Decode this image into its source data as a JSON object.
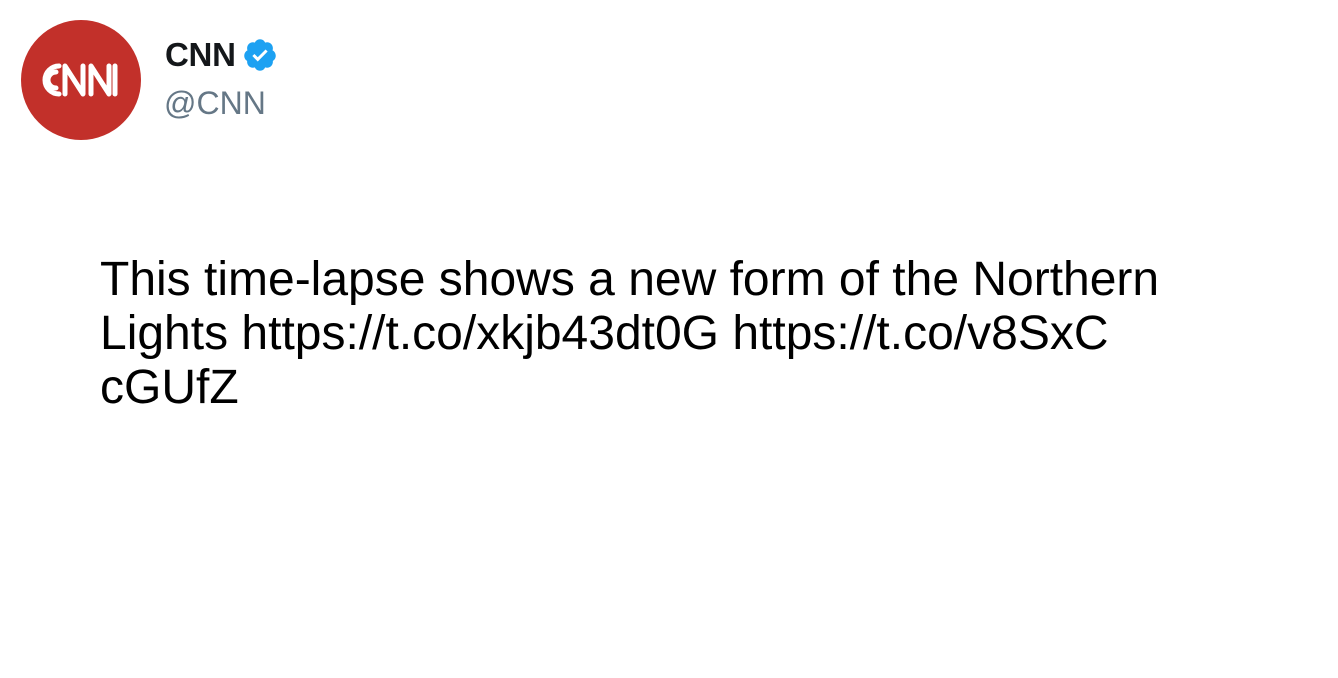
{
  "author": {
    "display_name": "CNN",
    "handle": "@CNN",
    "verified": true,
    "avatar_logo_text": "CNN",
    "avatar_color": "#c2302a",
    "verified_color": "#1da1f2"
  },
  "tweet": {
    "lines": [
      "This time-lapse shows a new form of the Northern",
      "Lights https://t.co/xkjb43dt0G https://t.co/v8SxC",
      "cGUfZ"
    ]
  }
}
